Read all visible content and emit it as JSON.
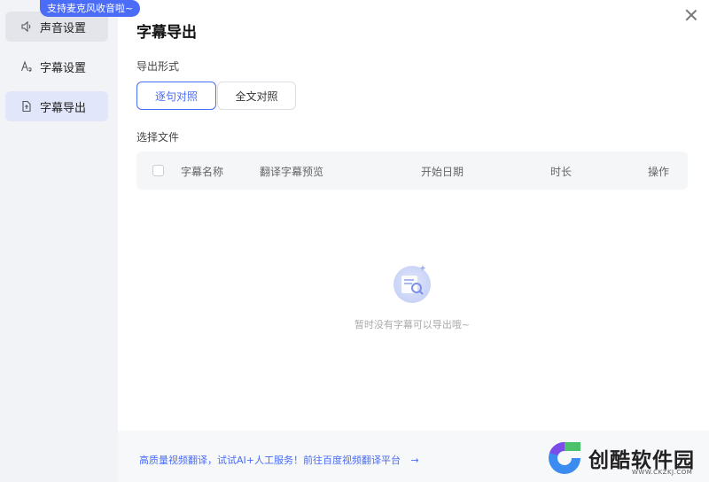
{
  "badge": "支持麦克风收音啦~",
  "sidebar": {
    "items": [
      {
        "label": "声音设置",
        "icon": "speaker-icon"
      },
      {
        "label": "字幕设置",
        "icon": "font-icon"
      },
      {
        "label": "字幕导出",
        "icon": "export-file-icon"
      }
    ]
  },
  "main": {
    "title": "字幕导出",
    "export_format_label": "导出形式",
    "options": [
      "逐句对照",
      "全文对照"
    ],
    "selected_option": "逐句对照",
    "select_file_label": "选择文件",
    "table": {
      "columns": [
        "字幕名称",
        "翻译字幕预览",
        "开始日期",
        "时长",
        "操作"
      ]
    },
    "empty_text": "暂时没有字幕可以导出哦~"
  },
  "footer": {
    "link_text": "高质量视频翻译，试试AI+人工服务！前往百度视频翻译平台",
    "arrow": "→"
  },
  "watermark": {
    "name": "创酷软件园",
    "url": "WWW.CKZKJ.COM"
  },
  "colors": {
    "accent": "#4a6cf7",
    "sidebar_bg": "#f2f3f7",
    "active_bg": "#e1e6fa"
  }
}
